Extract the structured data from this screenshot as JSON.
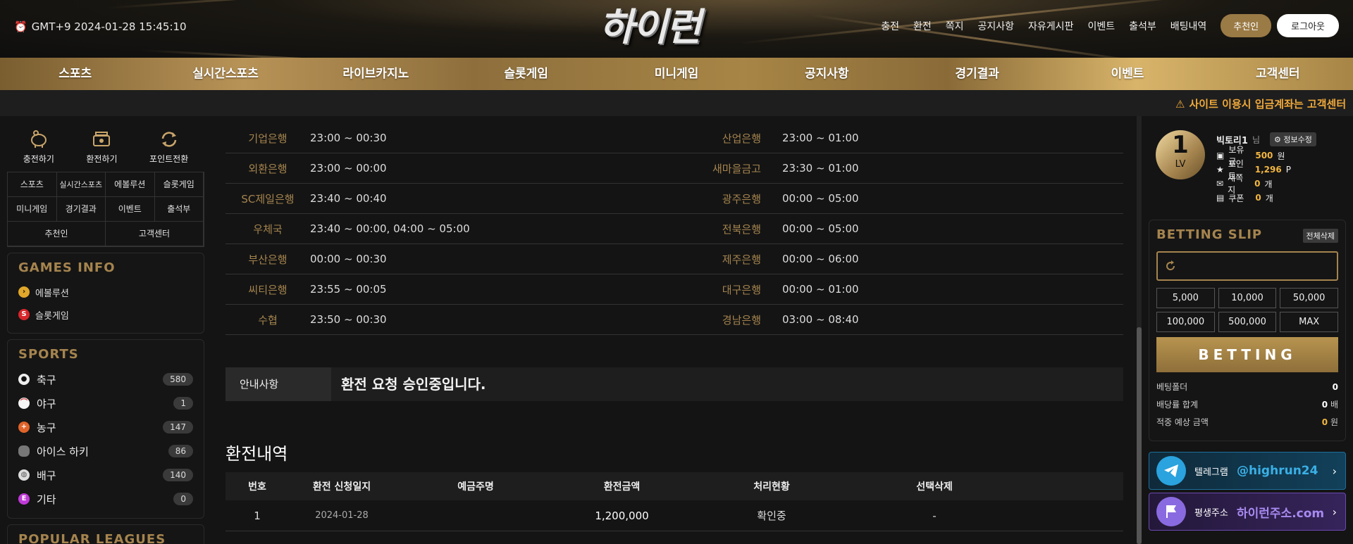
{
  "header": {
    "clock": "GMT+9 2024-01-28 15:45:10",
    "logo": "하이런",
    "nav": [
      "충전",
      "환전",
      "쪽지",
      "공지사항",
      "자유게시판",
      "이벤트",
      "출석부",
      "배팅내역"
    ],
    "recommend_btn": "추천인",
    "logout_btn": "로그아웃"
  },
  "gnb": [
    "스포츠",
    "실시간스포츠",
    "라이브카지노",
    "슬롯게임",
    "미니게임",
    "공지사항",
    "경기결과",
    "이벤트",
    "고객센터"
  ],
  "notice": "사이트 이용시 입금계좌는 고객센터",
  "left": {
    "quick": [
      "충전하기",
      "환전하기",
      "포인트전환"
    ],
    "grid": [
      "스포츠",
      "실시간스포츠",
      "에볼루션",
      "슬롯게임",
      "미니게임",
      "경기결과",
      "이벤트",
      "출석부",
      "추천인",
      "고객센터"
    ],
    "games_title": "GAMES INFO",
    "games": [
      "에볼루션",
      "슬롯게임"
    ],
    "sports_title": "SPORTS",
    "sports": [
      {
        "name": "축구",
        "count": "580"
      },
      {
        "name": "야구",
        "count": "1"
      },
      {
        "name": "농구",
        "count": "147"
      },
      {
        "name": "아이스 하키",
        "count": "86"
      },
      {
        "name": "배구",
        "count": "140"
      },
      {
        "name": "기타",
        "count": "0"
      }
    ],
    "popular_title": "POPULAR LEAGUES"
  },
  "banks": [
    {
      "l": "기업은행",
      "lt": "23:00 ~ 00:30",
      "r": "산업은행",
      "rt": "23:00 ~ 01:00"
    },
    {
      "l": "외환은행",
      "lt": "23:00 ~ 00:00",
      "r": "새마을금고",
      "rt": "23:30 ~ 01:00"
    },
    {
      "l": "SC제일은행",
      "lt": "23:40 ~ 00:40",
      "r": "광주은행",
      "rt": "00:00 ~ 05:00"
    },
    {
      "l": "우체국",
      "lt": "23:40 ~ 00:00, 04:00 ~ 05:00",
      "r": "전북은행",
      "rt": "00:00 ~ 05:00"
    },
    {
      "l": "부산은행",
      "lt": "00:00 ~ 00:30",
      "r": "제주은행",
      "rt": "00:00 ~ 06:00"
    },
    {
      "l": "씨티은행",
      "lt": "23:55 ~ 00:05",
      "r": "대구은행",
      "rt": "00:00 ~ 01:00"
    },
    {
      "l": "수협",
      "lt": "23:50 ~ 00:30",
      "r": "경남은행",
      "rt": "03:00 ~ 08:40"
    }
  ],
  "info": {
    "label": "안내사항",
    "text": "환전 요청 승인중입니다."
  },
  "history": {
    "title": "환전내역",
    "headers": [
      "번호",
      "환전 신청일지",
      "예금주명",
      "환전금액",
      "처리현황",
      "선택삭제"
    ],
    "rows": [
      [
        "1",
        "2024-01-28",
        "",
        "1,200,000",
        "확인중",
        "-"
      ]
    ]
  },
  "right": {
    "level": "1",
    "level_label": "LV",
    "user": "빅토리1",
    "user_suffix": "님",
    "edit": "정보수정",
    "stats": [
      {
        "k": "보유금",
        "v": "500",
        "u": "원"
      },
      {
        "k": "포인트",
        "v": "1,296",
        "u": "P"
      },
      {
        "k": "새쪽지",
        "v": "0",
        "u": "개"
      },
      {
        "k": "쿠폰",
        "v": "0",
        "u": "개"
      }
    ],
    "slip_title": "BETTING SLIP",
    "clear_all": "전체삭제",
    "amounts": [
      "5,000",
      "10,000",
      "50,000",
      "100,000",
      "500,000",
      "MAX"
    ],
    "bet_btn": "BETTING",
    "summary": [
      {
        "k": "베팅폴더",
        "v": "0",
        "u": ""
      },
      {
        "k": "배당률 합계",
        "v": "0",
        "u": "배"
      },
      {
        "k": "적중 예상 금액",
        "v": "0",
        "u": "원"
      }
    ],
    "telegram_label": "텔레그램",
    "telegram_id": "@highrun24",
    "addr_label": "평생주소",
    "addr": "하이런주소.com"
  }
}
